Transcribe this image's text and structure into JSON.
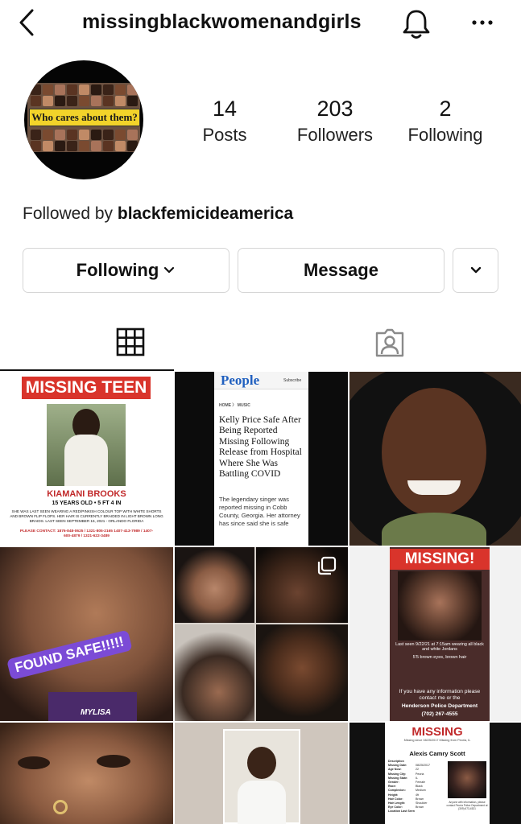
{
  "header": {
    "username": "missingblackwomenandgirls",
    "back_icon": "chevron-left-icon",
    "bell_icon": "bell-icon",
    "more_icon": "more-horizontal-icon"
  },
  "profile": {
    "avatar_banner": "Who cares about them?",
    "stats": [
      {
        "value": "14",
        "label": "Posts"
      },
      {
        "value": "203",
        "label": "Followers"
      },
      {
        "value": "2",
        "label": "Following"
      }
    ],
    "followed_by_prefix": "Followed by ",
    "followed_by_user": "blackfemicideamerica"
  },
  "actions": {
    "following_label": "Following",
    "message_label": "Message"
  },
  "tabs": {
    "grid_icon": "grid-icon",
    "tagged_icon": "tagged-person-icon"
  },
  "posts": {
    "p1": {
      "header": "MISSING TEEN",
      "name": "KIAMANI BROOKS",
      "details": "15 YEARS OLD • 5 FT 4 IN",
      "desc": "SHE WAS LAST SEEN WEARING A RED/PINKISH COLOUR TOP WITH WHITE SHORTS AND BROWN FLIP FLOPS. HER HAIR IS CURRENTLY BRAIDED IN LIGHT BROWN LONG BRAIDS. LAST SEEN SEPTEMBER 16, 2021 - ORLANDO FLORIDA",
      "contact": "PLEASE CONTACT: 1876-848-0625 / 1321-805-2165 1407-413-7989 / 1407-600-4879 / 1321-622-3489"
    },
    "p2": {
      "masthead": "People",
      "subscribe": "Subscribe",
      "breadcrumb": "HOME 〉 MUSIC",
      "headline": "Kelly Price Safe After Being Reported Missing Following Release from Hospital Where She Was Battling COVID",
      "summary": "The legendary singer was reported missing in Cobb County, Georgia. Her attorney has since said she is safe"
    },
    "p4": {
      "caption": "FOUND SAFE!!!!!",
      "shirt": "MYLISA"
    },
    "p6": {
      "header": "MISSING!",
      "note1": "Last seen 9/22/21 at 7:15am wearing all black and white Jordans",
      "note2": "5'5 brown eyes, brown hair",
      "appeal1": "If you have any information please contact me or the",
      "appeal2": "Henderson Police Department",
      "phone": "(702) 267-4555"
    },
    "p9": {
      "header": "MISSING",
      "sub": "Missing since 08/25/2017 Missing from Peoria, IL",
      "name": "Alexis Camry Scott",
      "fields": [
        "Description",
        "Missing Date:",
        "Age Now:",
        "Missing City:",
        "Missing State:",
        "Gender:",
        "Race:",
        "Complexion:",
        "Height:",
        "Hair Color:",
        "Hair Length:",
        "Eye Color:",
        "Location Last Seen"
      ],
      "values": [
        "",
        "08/25/2017",
        "22",
        "Peoria",
        "IL",
        "Female",
        "Black",
        "Medium",
        "4ft",
        "Brown",
        "Shoulder",
        "Brown",
        ""
      ],
      "footnote": "Anyone with information, please contact Peoria Police Department at (309) 673-4521"
    }
  },
  "colors": {
    "accent_red": "#d9342b",
    "banner_yellow": "#f2d32a",
    "found_purple": "#7b4bd6"
  }
}
